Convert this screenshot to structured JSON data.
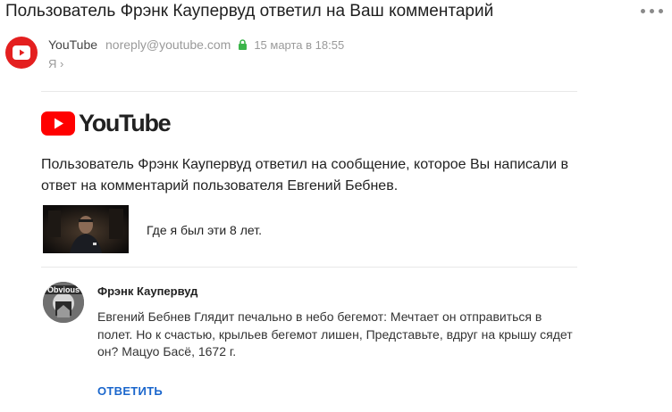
{
  "email": {
    "subject": "Пользователь Фрэнк Каупервуд ответил на Ваш комментарий",
    "sender_name": "YouTube",
    "sender_email": "noreply@youtube.com",
    "date": "15 марта в 18:55",
    "recipient": "Я ›"
  },
  "body": {
    "logo_text": "YouTube",
    "intro": "Пользователь Фрэнк Каупервуд ответил на сообщение, которое Вы написали в ответ на комментарий пользователя Евгений Бебнев.",
    "video_title": "Где я был эти 8 лет.",
    "commenter": "Фрэнк Каупервуд",
    "comment_text": "Евгений Бебнев Глядит печально в небо бегемот: Мечтает он отправиться в полет. Но к счастью, крыльев бегемот лишен, Представьте, вдруг на крышу сядет он? Мацуо Басё, 1672 г.",
    "avatar_text": "Obvious",
    "reply_label": "ОТВЕТИТЬ"
  },
  "colors": {
    "youtube_red": "#e41f1f",
    "link_blue": "#1a66cc",
    "secure_green": "#3bb54a"
  },
  "icons": [
    "more-menu-icon",
    "youtube-play-icon",
    "lock-icon",
    "youtube-logo-icon"
  ]
}
